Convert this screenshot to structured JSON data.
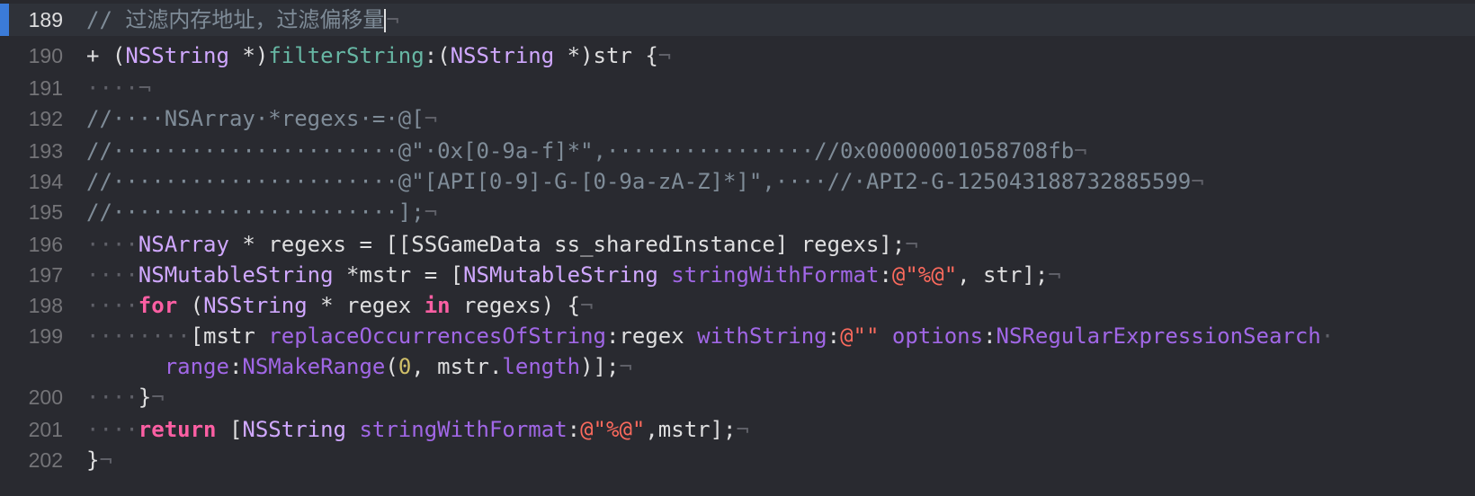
{
  "editor": {
    "current_line": "189",
    "lines": [
      {
        "num": "189",
        "segments": [
          {
            "t": "// ",
            "c": "cmt"
          },
          {
            "t": "过滤内存地址，过滤偏移量",
            "c": "cmt"
          },
          {
            "t": "¬",
            "c": "inv"
          }
        ]
      },
      {
        "num": "190",
        "segments": [
          {
            "t": "+ (",
            "c": "plain"
          },
          {
            "t": "NSString",
            "c": "typ"
          },
          {
            "t": " *)",
            "c": "plain"
          },
          {
            "t": "filterString",
            "c": "meth"
          },
          {
            "t": ":(",
            "c": "plain"
          },
          {
            "t": "NSString",
            "c": "typ"
          },
          {
            "t": " *)str {",
            "c": "plain"
          },
          {
            "t": "¬",
            "c": "inv"
          }
        ]
      },
      {
        "num": "191",
        "segments": [
          {
            "t": "····¬",
            "c": "inv"
          }
        ]
      },
      {
        "num": "192",
        "segments": [
          {
            "t": "//····NSArray·*regexs·=·@[",
            "c": "cmt"
          },
          {
            "t": "¬",
            "c": "inv"
          }
        ]
      },
      {
        "num": "193",
        "segments": [
          {
            "t": "//······················@\"·0x[0-9a-f]*\",················//0x00000001058708fb",
            "c": "cmt"
          },
          {
            "t": "¬",
            "c": "inv"
          }
        ]
      },
      {
        "num": "194",
        "segments": [
          {
            "t": "//······················@\"[API[0-9]-G-[0-9a-zA-Z]*]\",····//·API2-G-125043188732885599",
            "c": "cmt"
          },
          {
            "t": "¬",
            "c": "inv"
          }
        ]
      },
      {
        "num": "195",
        "segments": [
          {
            "t": "//······················];",
            "c": "cmt"
          },
          {
            "t": "¬",
            "c": "inv"
          }
        ]
      },
      {
        "num": "196",
        "segments": [
          {
            "t": "····",
            "c": "inv"
          },
          {
            "t": "NSArray",
            "c": "typ"
          },
          {
            "t": " * regexs = [[SSGameData ss_sharedInstance] regexs];",
            "c": "plain"
          },
          {
            "t": "¬",
            "c": "inv"
          }
        ]
      },
      {
        "num": "197",
        "segments": [
          {
            "t": "····",
            "c": "inv"
          },
          {
            "t": "NSMutableString",
            "c": "typ"
          },
          {
            "t": " *mstr = [",
            "c": "plain"
          },
          {
            "t": "NSMutableString",
            "c": "typ"
          },
          {
            "t": " ",
            "c": "plain"
          },
          {
            "t": "stringWithFormat",
            "c": "fn"
          },
          {
            "t": ":",
            "c": "plain"
          },
          {
            "t": "@\"%@\"",
            "c": "str"
          },
          {
            "t": ", str];",
            "c": "plain"
          },
          {
            "t": "¬",
            "c": "inv"
          }
        ]
      },
      {
        "num": "198",
        "segments": [
          {
            "t": "····",
            "c": "inv"
          },
          {
            "t": "for",
            "c": "kw"
          },
          {
            "t": " (",
            "c": "plain"
          },
          {
            "t": "NSString",
            "c": "typ"
          },
          {
            "t": " * regex ",
            "c": "plain"
          },
          {
            "t": "in",
            "c": "kw"
          },
          {
            "t": " regexs) {",
            "c": "plain"
          },
          {
            "t": "¬",
            "c": "inv"
          }
        ]
      },
      {
        "num": "199",
        "segments": [
          {
            "t": "········",
            "c": "inv"
          },
          {
            "t": "[mstr ",
            "c": "plain"
          },
          {
            "t": "replaceOccurrencesOfString",
            "c": "fn"
          },
          {
            "t": ":regex ",
            "c": "plain"
          },
          {
            "t": "withString",
            "c": "fn"
          },
          {
            "t": ":",
            "c": "plain"
          },
          {
            "t": "@\"\"",
            "c": "str"
          },
          {
            "t": " ",
            "c": "plain"
          },
          {
            "t": "options",
            "c": "fn"
          },
          {
            "t": ":",
            "c": "plain"
          },
          {
            "t": "NSRegularExpressionSearch",
            "c": "fn"
          },
          {
            "t": "·",
            "c": "inv"
          }
        ]
      },
      {
        "num": "",
        "segments": [
          {
            "t": "      ",
            "c": "plain"
          },
          {
            "t": "range",
            "c": "fn"
          },
          {
            "t": ":",
            "c": "plain"
          },
          {
            "t": "NSMakeRange",
            "c": "fn"
          },
          {
            "t": "(",
            "c": "plain"
          },
          {
            "t": "0",
            "c": "num"
          },
          {
            "t": ", mstr.",
            "c": "plain"
          },
          {
            "t": "length",
            "c": "fn"
          },
          {
            "t": ")];",
            "c": "plain"
          },
          {
            "t": "¬",
            "c": "inv"
          }
        ]
      },
      {
        "num": "200",
        "segments": [
          {
            "t": "····",
            "c": "inv"
          },
          {
            "t": "}",
            "c": "plain"
          },
          {
            "t": "¬",
            "c": "inv"
          }
        ]
      },
      {
        "num": "201",
        "segments": [
          {
            "t": "····",
            "c": "inv"
          },
          {
            "t": "return",
            "c": "kw"
          },
          {
            "t": " [",
            "c": "plain"
          },
          {
            "t": "NSString",
            "c": "typ"
          },
          {
            "t": " ",
            "c": "plain"
          },
          {
            "t": "stringWithFormat",
            "c": "fn"
          },
          {
            "t": ":",
            "c": "plain"
          },
          {
            "t": "@\"%@\"",
            "c": "str"
          },
          {
            "t": ",mstr];",
            "c": "plain"
          },
          {
            "t": "¬",
            "c": "inv"
          }
        ]
      },
      {
        "num": "202",
        "segments": [
          {
            "t": "}",
            "c": "plain"
          },
          {
            "t": "¬",
            "c": "inv"
          }
        ]
      }
    ]
  },
  "colors": {
    "background": "#292a30",
    "current_line_bg": "#2f3239",
    "gutter_marker": "#3b7bd8",
    "comment": "#7f8c98",
    "keyword": "#fc5fa3",
    "string": "#fc6a5d",
    "type": "#d0a8ff",
    "method_decl": "#67b7a4",
    "function": "#a167e6",
    "number": "#d0bf69",
    "plain": "#dfdfe0"
  }
}
